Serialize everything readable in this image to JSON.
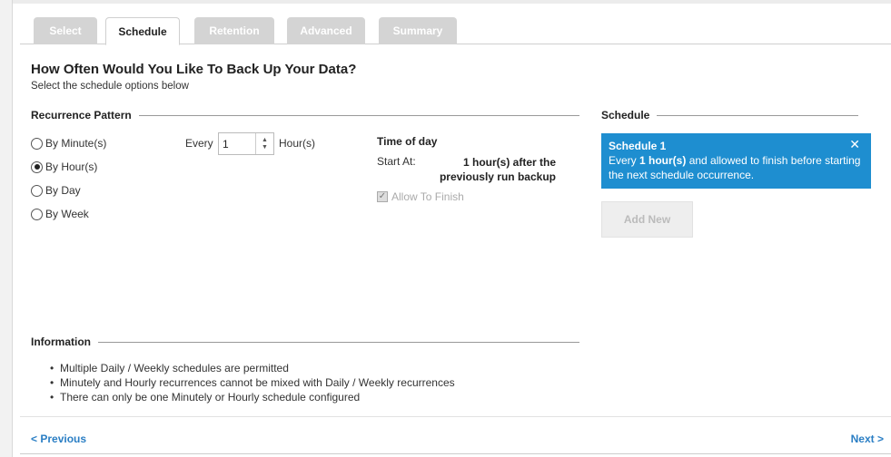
{
  "tabs": [
    {
      "label": "Select",
      "active": false
    },
    {
      "label": "Schedule",
      "active": true
    },
    {
      "label": "Retention",
      "active": false
    },
    {
      "label": "Advanced",
      "active": false
    },
    {
      "label": "Summary",
      "active": false
    }
  ],
  "header": {
    "title": "How Often Would You Like To Back Up Your Data?",
    "subtitle": "Select the schedule options below"
  },
  "recurrence": {
    "heading": "Recurrence Pattern",
    "options": [
      {
        "label": "By Minute(s)",
        "selected": false
      },
      {
        "label": "By Hour(s)",
        "selected": true
      },
      {
        "label": "By Day",
        "selected": false
      },
      {
        "label": "By Week",
        "selected": false
      }
    ],
    "every_label": "Every",
    "every_value": "1",
    "unit_label": "Hour(s)"
  },
  "time_of_day": {
    "title": "Time of day",
    "start_label": "Start At:",
    "start_value_line1": "1 hour(s) after the",
    "start_value_line2": "previously run backup",
    "allow_finish_label": "Allow To Finish",
    "allow_finish_checked": true
  },
  "schedule": {
    "heading": "Schedule",
    "card_title": "Schedule 1",
    "card_text_pre": "Every ",
    "card_text_bold": "1 hour(s)",
    "card_text_post": " and allowed to finish before starting the next schedule occurrence.",
    "close_glyph": "✕",
    "add_new_label": "Add New",
    "card_color": "#1e8ed0"
  },
  "information": {
    "heading": "Information",
    "items": [
      "Multiple Daily / Weekly schedules are permitted",
      "Minutely and Hourly recurrences cannot be mixed with Daily / Weekly recurrences",
      "There can only be one Minutely or Hourly schedule configured"
    ]
  },
  "footer": {
    "previous_label": "< Previous",
    "next_label": "Next >"
  }
}
